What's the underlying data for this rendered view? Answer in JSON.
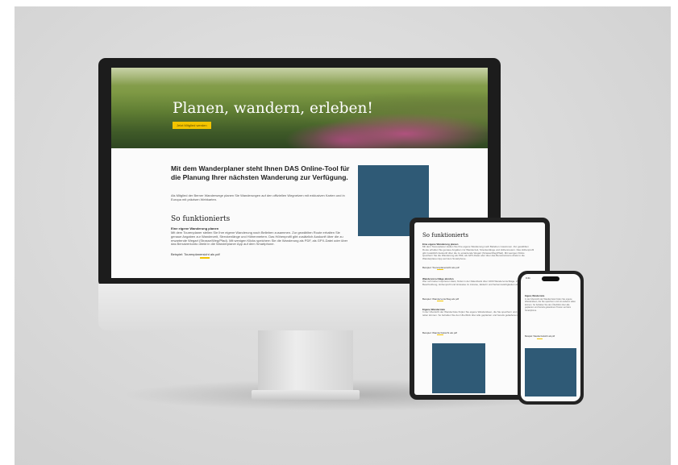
{
  "imac": {
    "hero_title": "Planen, wandern, erleben!",
    "hero_button": "Jetzt Mitglied werden",
    "intro_title": "Mit dem Wanderplaner steht Ihnen DAS Online-Tool für die Planung Ihrer nächsten Wanderung zur Verfügung.",
    "intro_text": "Als Mitglied der Berner Wanderwege planen Sie Wanderungen auf den offiziellen Wegnetzen mit exklusiven Karten und in Europa mit präzisen Webkarten.",
    "how_title": "So funktionierts",
    "how_subtitle": "Eine eigene Wanderung planen",
    "how_text": "Mit dem Tourenplaner stellen Sie Ihre eigene Wanderung nach Belieben zusammen. Zur gewählten Route erhalten Sie genaue Angaben zur Wanderzeit, Streckenlänge und Höhenmetern. Das Höhenprofil gibt zusätzlich Auskunft über die zu erwartende Wegart (Strasse/Weg/Pfad). Mit wenigen Klicks speichern Sie die Wanderung als PDF, als GPX-Datei oder über das Benutzerkonto direkt in die Wanderplaner App auf dem Smartphone.",
    "how_example": "Beispiel: Tourenplanersicht als pdf"
  },
  "tablet": {
    "title": "So funktionierts",
    "section1_head": "Eine eigene Wanderung planen",
    "section1_text": "Mit dem Tourenplaner stellen Sie Ihre eigene Wanderung nach Belieben zusammen. Zur gewählten Route erhalten Sie genaue Angaben zur Wanderzeit, Streckenlänge und Höhenmetern. Das Höhenprofil gibt zusätzlich Auskunft über die zu erwartende Wegart (Strasse/Weg/Pfad). Mit wenigen Klicks speichern Sie die Wanderung als PDF, als GPX-Datei oder über das Benutzerkonto direkt in die Wanderplaner App auf dem Smartphone.",
    "section1_example": "Beispiel: Tourenplanersicht als pdf",
    "section2_head": "Wandervorschläge abrufen",
    "section2_text": "Wer sich lieber inspirieren lässt, findet in der Datenbank über 1000 Wandervorschläge. Zu jeder Tour sind Beschreibung, Höhenprofil und Hinweise zu Anreise, Einkehr und Sehenswürdigkeiten abrufbar.",
    "section2_example": "Beispiel: Wandervorschlag als pdf",
    "section3_head": "Eigene Wanderziele",
    "section3_text": "In der Übersicht der Wanderziele finden Sie eigene Wanderideen, die Sie speichern und mit anderen teilen können. So behalten Sie den Überblick über alle geplanten und bereits gelaufenen Touren.",
    "section3_example": "Beispiel: Wanderzielsicht als pdf"
  },
  "phone": {
    "time": "9:41",
    "head": "Eigene Wanderziele",
    "text": "In der Übersicht der Wanderziele finden Sie eigene Wanderideen, die Sie speichern und mit anderen teilen können. So behalten Sie den Überblick über alle geplanten und bereits gelaufenen Touren auf dem Smartphone.",
    "example": "Beispiel: Wanderzielsicht als pdf"
  },
  "colors": {
    "accent": "#f3c400",
    "media_block": "#2f5a76",
    "device_frame": "#1c1c1c"
  }
}
